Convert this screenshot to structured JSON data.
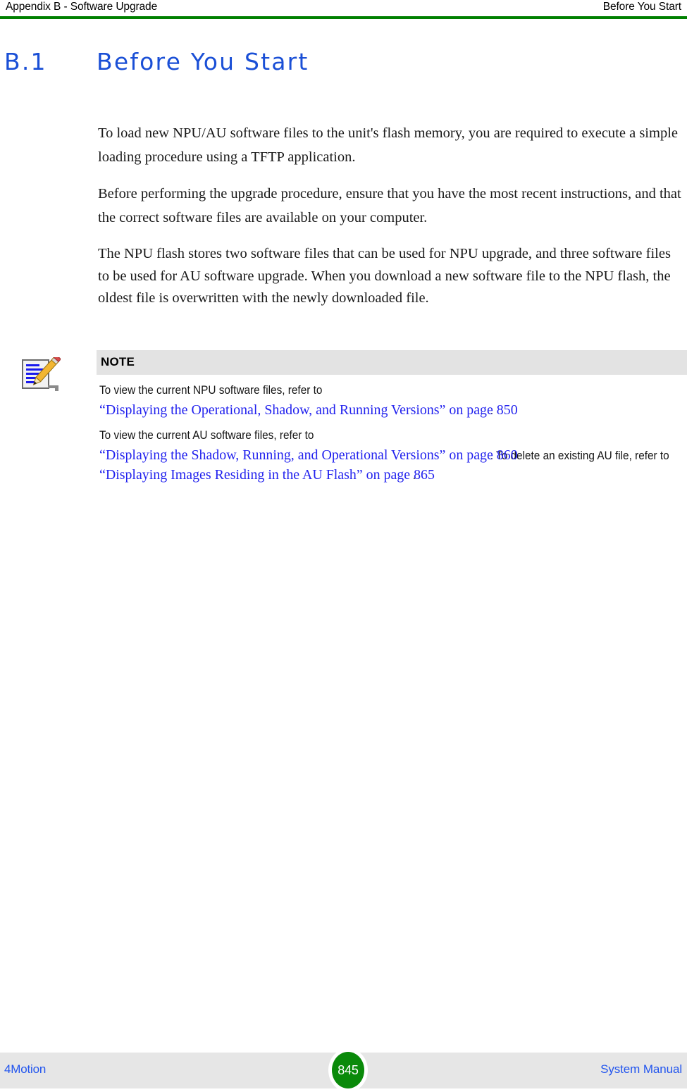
{
  "header": {
    "left": "Appendix B - Software Upgrade",
    "right": "Before You Start",
    "rule_color": "#008000"
  },
  "heading": {
    "number": "B.1",
    "title": "Before You Start",
    "color": "#1A4FD6"
  },
  "body": {
    "paragraphs": [
      "To load new NPU/AU software files to the unit's flash memory, you are required to execute a simple loading procedure using a TFTP application.",
      "Before performing the upgrade procedure, ensure that you have the most recent instructions, and that the correct software files are available on your computer.",
      "The NPU flash stores two software files that can be used for NPU upgrade, and three software files to be used for AU software upgrade. When you download a new software file to the NPU flash, the oldest file is overwritten with the newly downloaded file."
    ]
  },
  "note": {
    "icon_name": "note-pencil-icon",
    "header_label": "NOTE",
    "header_bg": "#e3e3e3",
    "paragraph1": {
      "lead": "To view the current NPU software files, refer to ",
      "xref": "“Displaying the Operational, Shadow, and Running Versions” on page 850",
      "tail": "."
    },
    "paragraph2": {
      "lead": "To view the current AU software files, refer to ",
      "xref1": "“Displaying the Shadow, Running, and Operational Versions” on page 860",
      "mid": ". To delete an existing AU file, refer to ",
      "xref2": "“Displaying Images Residing in the AU Flash” on page 865",
      "tail": "."
    },
    "link_color": "#2222EE"
  },
  "footer": {
    "left": "4Motion",
    "page_number": "845",
    "right": "System Manual",
    "badge_color": "#0a8a0a",
    "band_color": "#e6e6e6",
    "text_color": "#2255EE"
  }
}
